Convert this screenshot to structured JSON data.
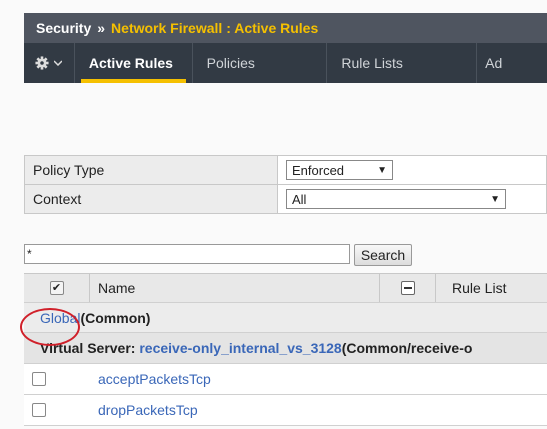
{
  "header": {
    "section": "Security",
    "separator": "»",
    "path": "Network Firewall : Active Rules"
  },
  "tabs": [
    {
      "label": "Active Rules",
      "active": true
    },
    {
      "label": "Policies",
      "active": false
    },
    {
      "label": "Rule Lists",
      "active": false
    },
    {
      "label": "Ad",
      "active": false
    }
  ],
  "settings": {
    "policy_type": {
      "label": "Policy Type",
      "value": "Enforced"
    },
    "context": {
      "label": "Context",
      "value": "All"
    }
  },
  "search": {
    "value": "*",
    "button_label": "Search"
  },
  "table": {
    "columns": {
      "name": "Name",
      "rule_list": "Rule List"
    },
    "header_check": "✔",
    "group": {
      "link": "Global",
      "suffix": " (Common)"
    },
    "virtual_server": {
      "prefix": "Virtual Server: ",
      "link": "receive-only_internal_vs_3128",
      "suffix": " (Common/receive-o"
    },
    "rows": [
      {
        "name": "acceptPacketsTcp"
      },
      {
        "name": "dropPacketsTcp"
      }
    ]
  },
  "colors": {
    "accent": "#f5c000",
    "link": "#3a67b8",
    "annotation": "#d0202a"
  }
}
